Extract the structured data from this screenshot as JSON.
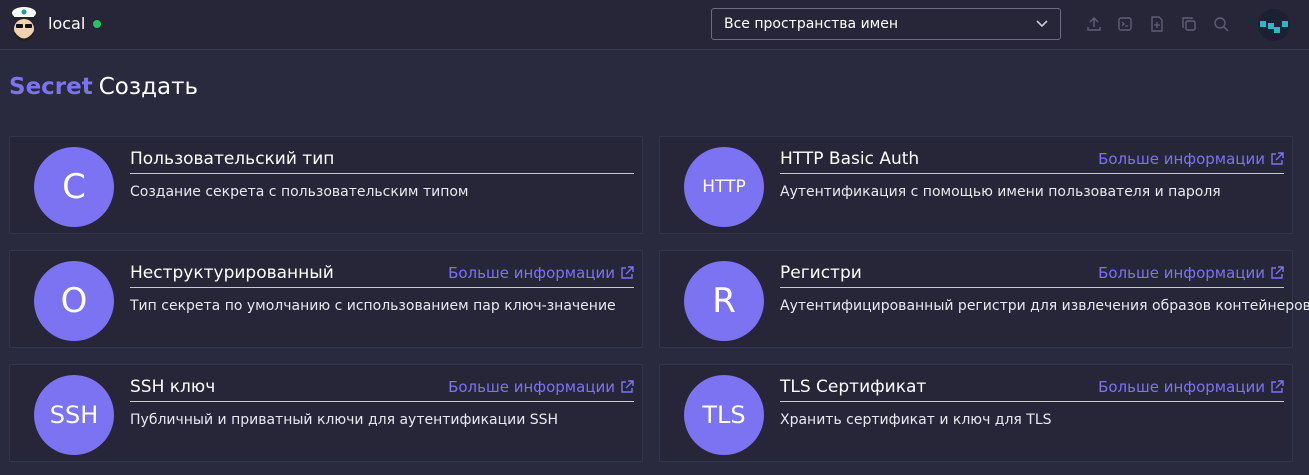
{
  "header": {
    "cluster_name": "local",
    "status_color": "#22c55e",
    "namespace_select": {
      "value": "Все пространства имен"
    },
    "tools": [
      "upload-icon",
      "terminal-icon",
      "file-plus-icon",
      "copy-icon",
      "search-icon"
    ]
  },
  "page_title": {
    "kind": "Secret",
    "action": "Создать"
  },
  "more_info_label": "Больше информации",
  "cards": [
    {
      "icon_text": "C",
      "title": "Пользовательский тип",
      "description": "Создание секрета с пользовательским типом",
      "has_more": false
    },
    {
      "icon_text": "HTTP",
      "title": "HTTP Basic Auth",
      "description": "Аутентификация с помощью имени пользователя и пароля",
      "has_more": true
    },
    {
      "icon_text": "O",
      "title": "Неструктурированный",
      "description": "Тип секрета по умолчанию с использованием пар ключ-значение",
      "has_more": true
    },
    {
      "icon_text": "R",
      "title": "Регистри",
      "description": "Аутентифицированный регистри для извлечения образов контейнеров",
      "has_more": true
    },
    {
      "icon_text": "SSH",
      "title": "SSH ключ",
      "description": "Публичный и приватный ключи для аутентификации SSH",
      "has_more": true
    },
    {
      "icon_text": "TLS",
      "title": "TLS Сертификат",
      "description": "Хранить сертификат и ключ для TLS",
      "has_more": true
    }
  ],
  "colors": {
    "accent": "#7c73f2",
    "background": "#2a2a3e",
    "card": "#262638"
  }
}
